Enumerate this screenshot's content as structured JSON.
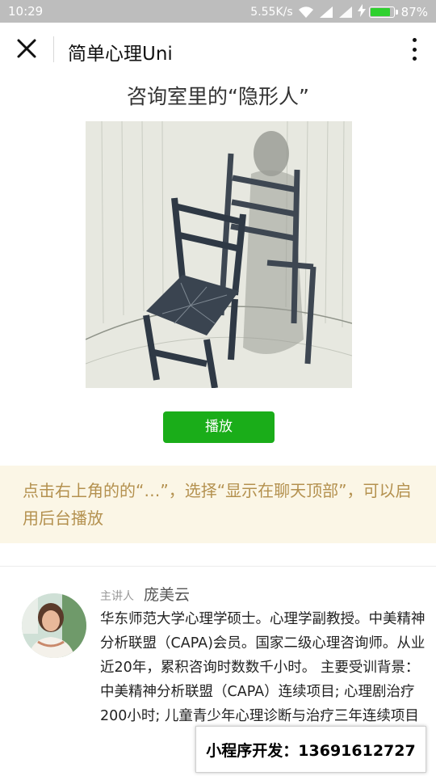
{
  "status_bar": {
    "time": "10:29",
    "network_speed": "5.55K/s",
    "battery_percent": "87%",
    "battery_level": 0.87,
    "battery_color": "#2fd12f"
  },
  "nav": {
    "title": "简单心理Uni",
    "close_icon": "close-icon",
    "more_icon": "more-vertical-icon"
  },
  "article": {
    "title": "咨询室里的“隐形人”",
    "cover_image": "chairs-with-shadow-illustration",
    "play_label": "播放",
    "play_color": "#1aad19"
  },
  "notice": {
    "text": "点击右上角的的“…”，选择“显示在聊天顶部”，可以启用后台播放",
    "background": "#fbf6e6",
    "text_color": "#b4914f"
  },
  "speaker": {
    "role_label": "主讲人",
    "name": "庞美云",
    "bio": "华东师范大学心理学硕士。心理学副教授。中美精神分析联盟（CAPA)会员。国家二级心理咨询师。从业近20年，累积咨询时数数千小时。 主要受训背景：中美精神分析联盟（CAPA）连续项目; 心理剧治疗200小时; 儿童青少年心理诊断与治疗三年连续项目"
  },
  "watermark": {
    "text": "小程序开发：13691612727"
  }
}
